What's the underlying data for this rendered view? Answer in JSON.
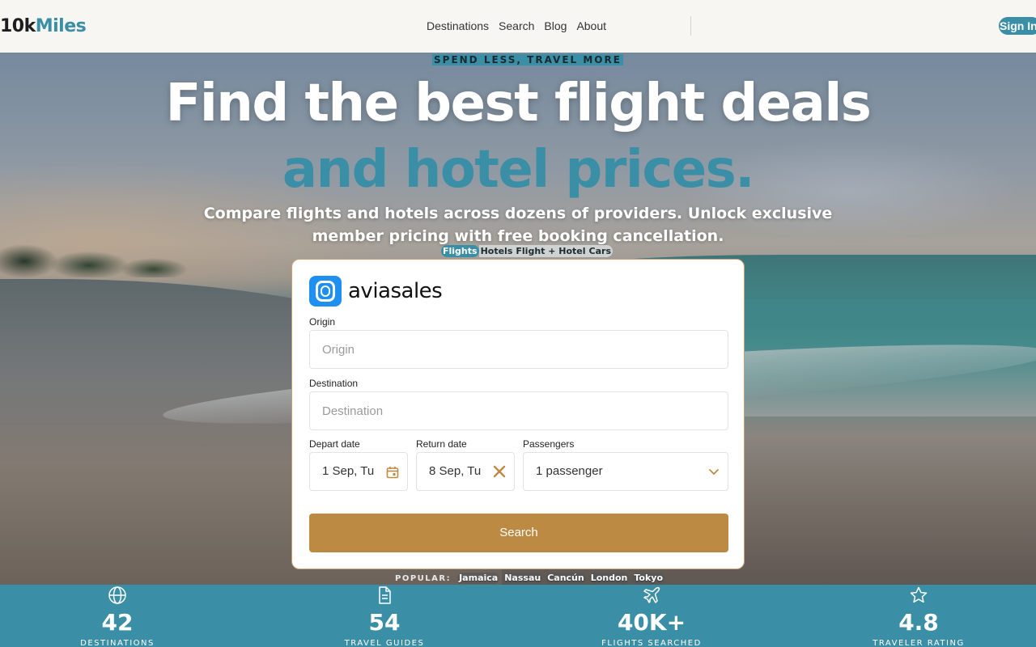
{
  "brand": {
    "logo_part1": "10k",
    "logo_part2": "Miles"
  },
  "nav": {
    "links": [
      "Destinations",
      "Search",
      "Blog",
      "About"
    ],
    "signin_label": "Sign In"
  },
  "hero": {
    "eyebrow": "SPEND LESS, TRAVEL MORE",
    "title_line1": "Find the best flight deals",
    "title_line2": "and hotel prices.",
    "subtitle": "Compare flights and hotels across dozens of providers. Unlock exclusive member pricing with free booking cancellation.",
    "tabs": [
      "Flights",
      "Hotels",
      "Flight + Hotel",
      "Cars"
    ],
    "active_tab": "Flights"
  },
  "widget": {
    "provider": "aviasales",
    "origin_label": "Origin",
    "origin_placeholder": "Origin",
    "destination_label": "Destination",
    "destination_placeholder": "Destination",
    "depart_label": "Depart date",
    "depart_value": "1 Sep, Tu",
    "return_label": "Return date",
    "return_value": "8 Sep, Tu",
    "passengers_label": "Passengers",
    "passengers_value": "1 passenger",
    "search_label": "Search",
    "accent": "#bd8a43"
  },
  "popular": {
    "label": "POPULAR:",
    "items": [
      "Jamaica",
      "Nassau",
      "Cancún",
      "London",
      "Tokyo"
    ]
  },
  "stats": [
    {
      "icon": "globe-icon",
      "value": "42",
      "caption": "DESTINATIONS"
    },
    {
      "icon": "document-icon",
      "value": "54",
      "caption": "TRAVEL GUIDES"
    },
    {
      "icon": "plane-icon",
      "value": "40K+",
      "caption": "FLIGHTS SEARCHED"
    },
    {
      "icon": "star-icon",
      "value": "4.8",
      "caption": "TRAVELER RATING"
    }
  ],
  "colors": {
    "primary": "#3a8ea6",
    "accent": "#bd8a43",
    "nav_bg": "#f7f6f3"
  }
}
